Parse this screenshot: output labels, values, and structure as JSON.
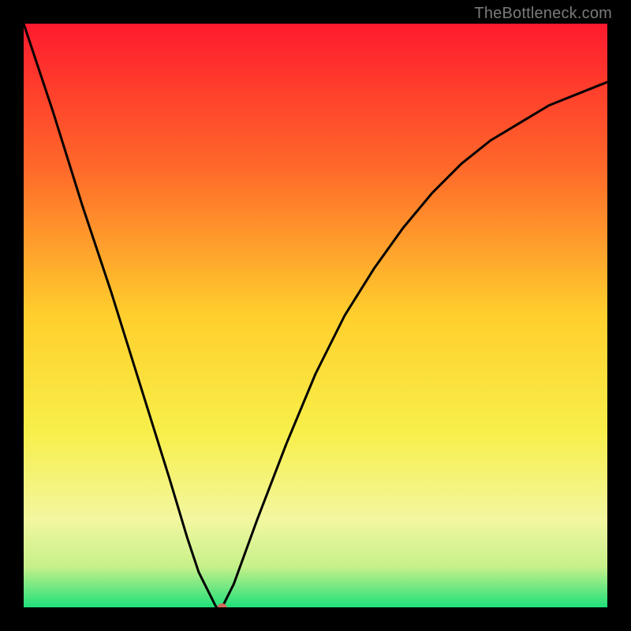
{
  "watermark": "TheBottleneck.com",
  "chart_data": {
    "type": "line",
    "title": "",
    "xlabel": "",
    "ylabel": "",
    "xlim": [
      0,
      100
    ],
    "ylim": [
      0,
      100
    ],
    "grid": false,
    "legend": false,
    "background_gradient": {
      "stops": [
        {
          "offset": 0.0,
          "color": "#ff1a2e"
        },
        {
          "offset": 0.25,
          "color": "#ff6a2a"
        },
        {
          "offset": 0.5,
          "color": "#ffcf2d"
        },
        {
          "offset": 0.7,
          "color": "#f8ef4a"
        },
        {
          "offset": 0.85,
          "color": "#f2f7a0"
        },
        {
          "offset": 0.93,
          "color": "#c7f08a"
        },
        {
          "offset": 1.0,
          "color": "#1fe07a"
        }
      ]
    },
    "series": [
      {
        "name": "bottleneck-curve",
        "color": "#000000",
        "x": [
          0,
          5,
          10,
          15,
          20,
          25,
          28,
          30,
          32,
          33,
          34,
          36,
          40,
          45,
          50,
          55,
          60,
          65,
          70,
          75,
          80,
          85,
          90,
          95,
          100
        ],
        "y": [
          100,
          85,
          69,
          54,
          38,
          22,
          12,
          6,
          2,
          0,
          0,
          4,
          15,
          28,
          40,
          50,
          58,
          65,
          71,
          76,
          80,
          83,
          86,
          88,
          90
        ]
      }
    ],
    "marker": {
      "name": "optimal-point",
      "x": 34,
      "y": 0,
      "color": "#d46a5c",
      "rx": 6,
      "ry": 5
    }
  }
}
